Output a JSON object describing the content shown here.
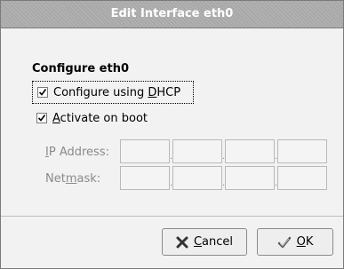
{
  "window": {
    "title": "Edit Interface eth0"
  },
  "section": {
    "title": "Configure eth0"
  },
  "options": {
    "dhcp": {
      "pre": "Configure using ",
      "mn": "D",
      "post": "HCP",
      "checked": true
    },
    "boot": {
      "pre": "",
      "mn": "A",
      "post": "ctivate on boot",
      "checked": true
    }
  },
  "fields": {
    "ip": {
      "pre": "",
      "mn": "I",
      "post": "P Address:",
      "octets": [
        "",
        "",
        "",
        ""
      ]
    },
    "mask": {
      "pre": "Net",
      "mn": "m",
      "post": "ask:",
      "octets": [
        "",
        "",
        "",
        ""
      ]
    },
    "octet_separator": "."
  },
  "buttons": {
    "cancel": {
      "mn": "C",
      "post": "ancel",
      "icon": "cancel-x-icon"
    },
    "ok": {
      "mn": "O",
      "post": "K",
      "icon": "checkmark-icon"
    }
  },
  "colors": {
    "disabled_text": "#8a8a8a",
    "title_text": "#ffffff"
  }
}
